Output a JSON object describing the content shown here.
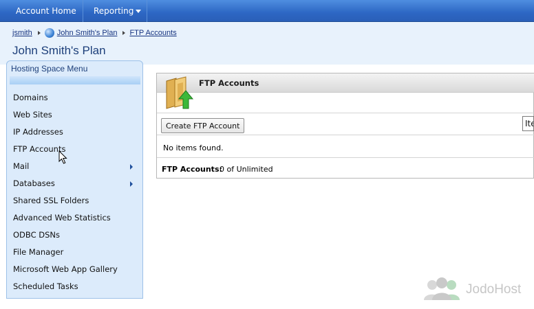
{
  "nav": {
    "items": [
      {
        "label": "Account Home"
      },
      {
        "label": "Reporting"
      }
    ]
  },
  "breadcrumb": {
    "items": [
      "jsmith",
      "John Smith's Plan",
      "FTP Accounts"
    ]
  },
  "page": {
    "title": "John Smith's Plan"
  },
  "menu": {
    "title": "Hosting Space Menu",
    "items": [
      {
        "label": "Domains"
      },
      {
        "label": "Web Sites"
      },
      {
        "label": "IP Addresses"
      },
      {
        "label": "FTP Accounts"
      },
      {
        "label": "Mail",
        "submenu": true
      },
      {
        "label": "Databases",
        "submenu": true
      },
      {
        "label": "Shared SSL Folders"
      },
      {
        "label": "Advanced Web Statistics"
      },
      {
        "label": "ODBC DSNs"
      },
      {
        "label": "File Manager"
      },
      {
        "label": "Microsoft Web App Gallery"
      },
      {
        "label": "Scheduled Tasks"
      }
    ]
  },
  "panel": {
    "title": "FTP Accounts",
    "create_button": "Create FTP Account",
    "items_field_value": "Ite",
    "empty_message": "No items found.",
    "footer_label": "FTP Accounts:",
    "footer_value": "0 of Unlimited"
  },
  "watermark": {
    "text": "JodoHost"
  },
  "colors": {
    "nav_bar": "#2d67c4",
    "header_bg": "#e8f2fc",
    "menu_bg": "#dcebfb",
    "link": "#15337f"
  }
}
